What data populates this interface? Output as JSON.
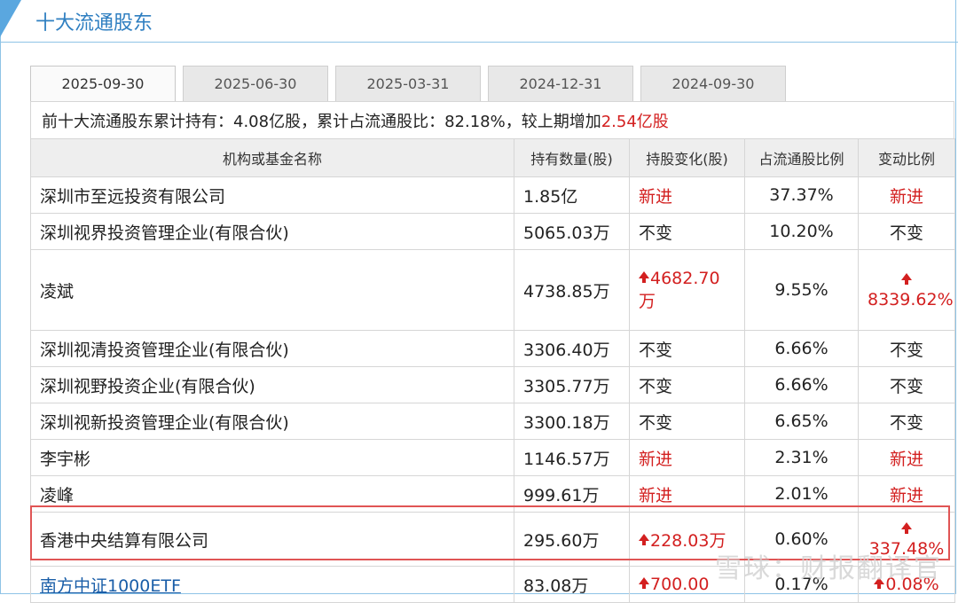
{
  "section_title": "十大流通股东",
  "tabs": [
    {
      "label": "2025-09-30",
      "active": true
    },
    {
      "label": "2025-06-30",
      "active": false
    },
    {
      "label": "2025-03-31",
      "active": false
    },
    {
      "label": "2024-12-31",
      "active": false
    },
    {
      "label": "2024-09-30",
      "active": false
    }
  ],
  "summary": {
    "prefix": "前十大流通股东累计持有：4.08亿股，累计占流通股比：82.18%，较上期增加",
    "change": "2.54亿股"
  },
  "table": {
    "headers": [
      "机构或基金名称",
      "持有数量(股)",
      "持股变化(股)",
      "占流通股比例",
      "变动比例"
    ],
    "rows": [
      {
        "name": "深圳市至远投资有限公司",
        "qty": "1.85亿",
        "change": "新进",
        "ratio": "37.37%",
        "pct": "新进"
      },
      {
        "name": "深圳视界投资管理企业(有限合伙)",
        "qty": "5065.03万",
        "change": "不变",
        "ratio": "10.20%",
        "pct": "不变"
      },
      {
        "name": "凌斌",
        "qty": "4738.85万",
        "change": "4682.70万",
        "ratio": "9.55%",
        "pct": "8339.62%"
      },
      {
        "name": "深圳视清投资管理企业(有限合伙)",
        "qty": "3306.40万",
        "change": "不变",
        "ratio": "6.66%",
        "pct": "不变"
      },
      {
        "name": "深圳视野投资企业(有限合伙)",
        "qty": "3305.77万",
        "change": "不变",
        "ratio": "6.66%",
        "pct": "不变"
      },
      {
        "name": "深圳视新投资管理企业(有限合伙)",
        "qty": "3300.18万",
        "change": "不变",
        "ratio": "6.65%",
        "pct": "不变"
      },
      {
        "name": "李宇彬",
        "qty": "1146.57万",
        "change": "新进",
        "ratio": "2.31%",
        "pct": "新进"
      },
      {
        "name": "凌峰",
        "qty": "999.61万",
        "change": "新进",
        "ratio": "2.01%",
        "pct": "新进"
      },
      {
        "name": "香港中央结算有限公司",
        "qty": "295.60万",
        "change": "228.03万",
        "ratio": "0.60%",
        "pct": "337.48%"
      },
      {
        "name": "南方中证1000ETF",
        "qty": "83.08万",
        "change": "700.00",
        "ratio": "0.17%",
        "pct": "0.08%"
      }
    ]
  },
  "watermark": "雪球：财报翻译官",
  "colors": {
    "accent": "#2f7fc1",
    "increase": "#d32020",
    "highlight_border": "#e05555"
  }
}
